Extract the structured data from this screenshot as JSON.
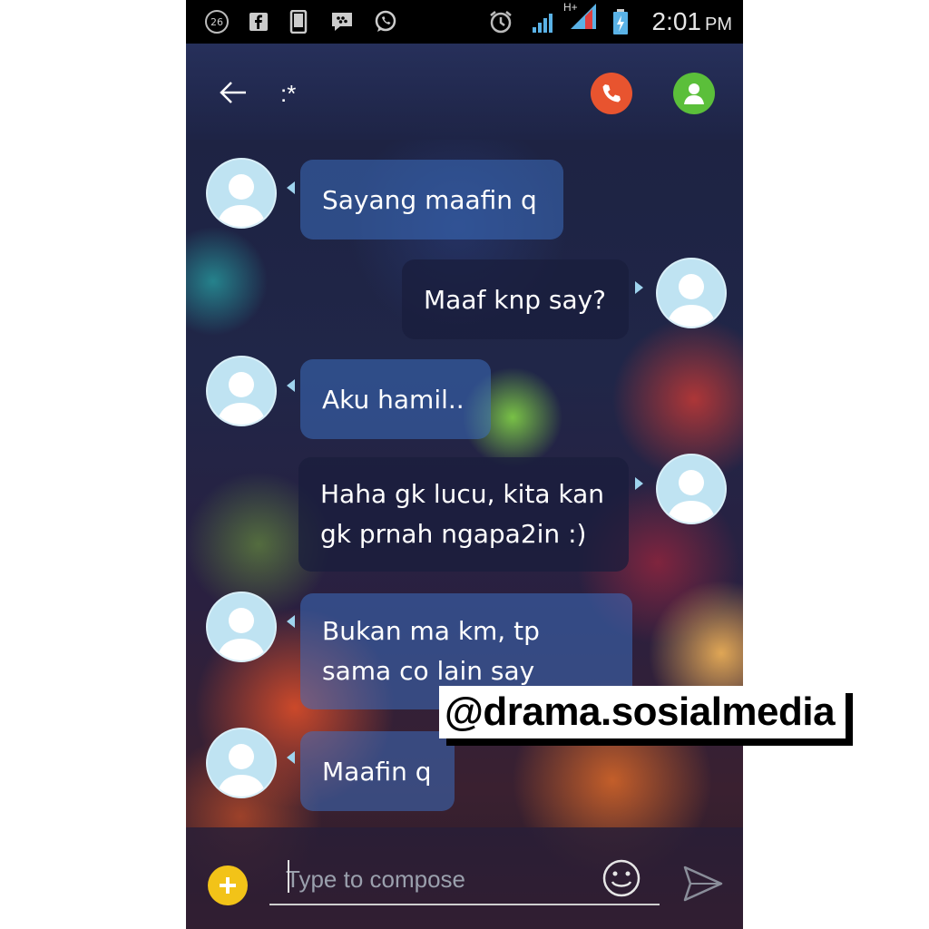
{
  "status_bar": {
    "notification_count": "26",
    "network": "H+",
    "time": "2:01",
    "ampm": "PM"
  },
  "toolbar": {
    "back_icon": "arrow-left-icon",
    "title": ":*",
    "call_icon": "phone-icon",
    "contact_icon": "person-icon",
    "call_color": "#e8542f",
    "contact_color": "#5bbf3a"
  },
  "messages": [
    {
      "direction": "in",
      "lines": [
        "Sayang maafin q"
      ]
    },
    {
      "direction": "out",
      "lines": [
        "Maaf knp say?"
      ]
    },
    {
      "direction": "in",
      "lines": [
        "Aku hamil.."
      ]
    },
    {
      "direction": "out",
      "lines": [
        "Haha gk lucu, kita kan",
        "gk prnah ngapa2in :)"
      ]
    },
    {
      "direction": "in",
      "lines": [
        "Bukan ma km, tp",
        "sama co lain say"
      ]
    },
    {
      "direction": "in",
      "lines": [
        "Maafin q"
      ]
    }
  ],
  "composer": {
    "placeholder": "Type to compose",
    "add_icon": "plus-icon",
    "emoji_icon": "smiley-icon",
    "send_icon": "send-icon"
  },
  "watermark": "@drama.sosialmedia"
}
